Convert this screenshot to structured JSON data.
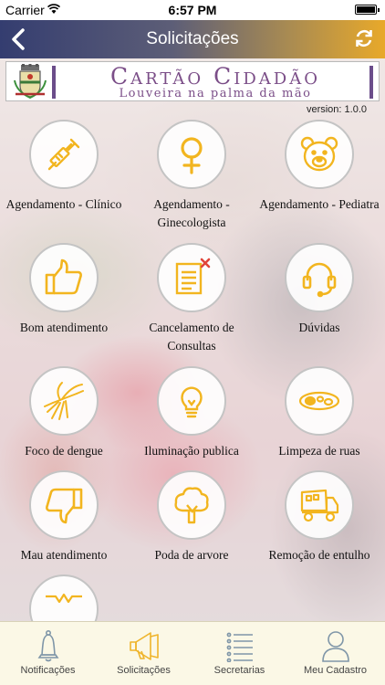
{
  "status_bar": {
    "carrier": "Carrier",
    "time": "6:57 PM"
  },
  "navbar": {
    "title": "Solicitações",
    "back_icon": "chevron-left-icon",
    "refresh_icon": "refresh-icon"
  },
  "banner": {
    "title": "Cartão Cidadão",
    "subtitle": "Louveira na palma da mão"
  },
  "version": "version: 1.0.0",
  "services": [
    {
      "label": "Agendamento - Clínico",
      "icon": "syringe-icon"
    },
    {
      "label": "Agendamento - Ginecologista",
      "icon": "female-symbol-icon"
    },
    {
      "label": "Agendamento - Pediatra",
      "icon": "teddy-bear-icon"
    },
    {
      "label": "Bom atendimento",
      "icon": "thumbs-up-icon"
    },
    {
      "label": "Cancelamento de Consultas",
      "icon": "document-cancel-icon"
    },
    {
      "label": "Dúvidas",
      "icon": "headset-icon"
    },
    {
      "label": "Foco de dengue",
      "icon": "mosquito-icon"
    },
    {
      "label": "Iluminação publica",
      "icon": "light-bulb-icon"
    },
    {
      "label": "Limpeza de ruas",
      "icon": "street-sweeper-icon"
    },
    {
      "label": "Mau atendimento",
      "icon": "thumbs-down-icon"
    },
    {
      "label": "Poda de arvore",
      "icon": "tree-icon"
    },
    {
      "label": "Remoção de entulho",
      "icon": "dump-truck-icon"
    }
  ],
  "partial_tile_icon": "pothole-icon",
  "tabs": [
    {
      "label": "Notificações",
      "icon": "bell-icon"
    },
    {
      "label": "Solicitações",
      "icon": "megaphone-icon"
    },
    {
      "label": "Secretarias",
      "icon": "list-icon"
    },
    {
      "label": "Meu Cadastro",
      "icon": "user-icon"
    }
  ],
  "colors": {
    "accent": "#f2b51f",
    "nav_start": "#343d70",
    "nav_end": "#e8a92a",
    "brand_purple": "#7b4e88",
    "tabbar_bg": "#fbf8e6"
  }
}
